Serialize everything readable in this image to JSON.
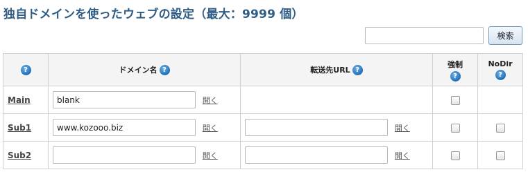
{
  "header": {
    "title": "独自ドメインを使ったウェブの設定（最大：9999 個）"
  },
  "search": {
    "value": "",
    "button_label": "検索"
  },
  "table": {
    "columns": {
      "help_label": "?",
      "domain": "ドメイン名",
      "forward_url": "転送先URL",
      "force": "強制",
      "nodir": "NoDir"
    },
    "rows": [
      {
        "label": "Main",
        "domain_value": "blank",
        "domain_open": "開く",
        "url_value": "",
        "url_open": "",
        "force_checked": false,
        "nodir_checked": false
      },
      {
        "label": "Sub1",
        "domain_value": "www.kozooo.biz",
        "domain_open": "開く",
        "url_value": "",
        "url_open": "開く",
        "force_checked": false,
        "nodir_checked": false
      },
      {
        "label": "Sub2",
        "domain_value": "",
        "domain_open": "開く",
        "url_value": "",
        "url_open": "開く",
        "force_checked": false,
        "nodir_checked": false
      }
    ]
  },
  "colors": {
    "title": "#2f5d86",
    "help_icon": "#1f6fb8",
    "header_bg": "#f4f4f4",
    "border": "#d0d0d0"
  }
}
